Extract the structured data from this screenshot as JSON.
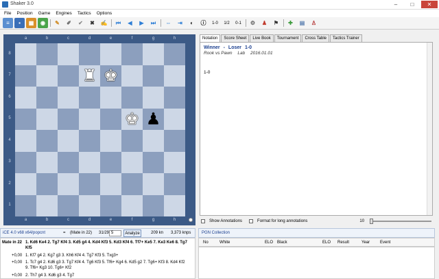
{
  "window": {
    "title": "Shaker 3.0",
    "minimize": "–",
    "maximize": "□",
    "close": "✕"
  },
  "menu": [
    "File",
    "Position",
    "Game",
    "Engines",
    "Tactics",
    "Options"
  ],
  "toolbar": {
    "labels": [
      "1-0",
      "1/2",
      "0-1"
    ]
  },
  "board": {
    "files": [
      "a",
      "b",
      "c",
      "d",
      "e",
      "f",
      "g",
      "h"
    ],
    "ranks": [
      "8",
      "7",
      "6",
      "5",
      "4",
      "3",
      "2",
      "1"
    ],
    "pieces": {
      "d7": "♜",
      "e7": "♚",
      "f5": "♚",
      "g5": "♟"
    },
    "piece_colors": {
      "d7": "white",
      "e7": "white",
      "f5": "white",
      "g5": "black"
    }
  },
  "tabs": [
    "Notation",
    "Score Sheet",
    "Live Book",
    "Tournament",
    "Cross Table",
    "Tactics Trainer"
  ],
  "notation": {
    "white": "Winner",
    "dash": "-",
    "black": "Loser",
    "result": "1-0",
    "event": "Rook vs Pawn",
    "site": "Lab",
    "date": "2016.01.01",
    "moves": "1-0"
  },
  "options": {
    "show_annotations": "Show Annotations",
    "long_annotations": "Format for long annotations",
    "slider_value": "10"
  },
  "engine": {
    "name": "iCE 4.0 v68 x64/popcnt",
    "equals": "=",
    "mate": "(Mate in 22)",
    "depth": "31/29",
    "lines": "5",
    "analyze": "Analyze",
    "nodes": "209 kn",
    "speed": "3,373 knps"
  },
  "analysis": [
    {
      "score": "Mate in 22",
      "line": "1. Kd6 Ke4 2. Tg7 Kf4 3. Kd5 g4 4. Kd4 Kf3 5. Kd3 Kf4 6. Tf7+ Ke5 7. Ke3 Ke6 8. Tg7",
      "cont": "Kf5"
    },
    {
      "score": "+0,00",
      "line": "1. Kf7 g4 2. Kg7 g3 3. Kh6 Kf4 4. Tg7 Kf3 5. Txg3+",
      "cont": ""
    },
    {
      "score": "+0,00",
      "line": "1. Tc7 g4 2. Kd6 g3 3. Tg7 Kf4 4. Tg6 Kf3 5. Tf6+ Kg4 6. Kd5 g2 7. Tg6+ Kf3 8. Kd4 Kf2",
      "cont": "9. Tf6+ Kg3 10. Tg6+ Kf2"
    },
    {
      "score": "+0,00",
      "line": "2. Th7 g4 3. Kd6 g3 4. Tg7",
      "cont": ""
    }
  ],
  "pgn": {
    "title": "PGN Collection",
    "columns": [
      "No",
      "White",
      "ELO",
      "Black",
      "ELO",
      "Result",
      "Year",
      "Event"
    ]
  }
}
